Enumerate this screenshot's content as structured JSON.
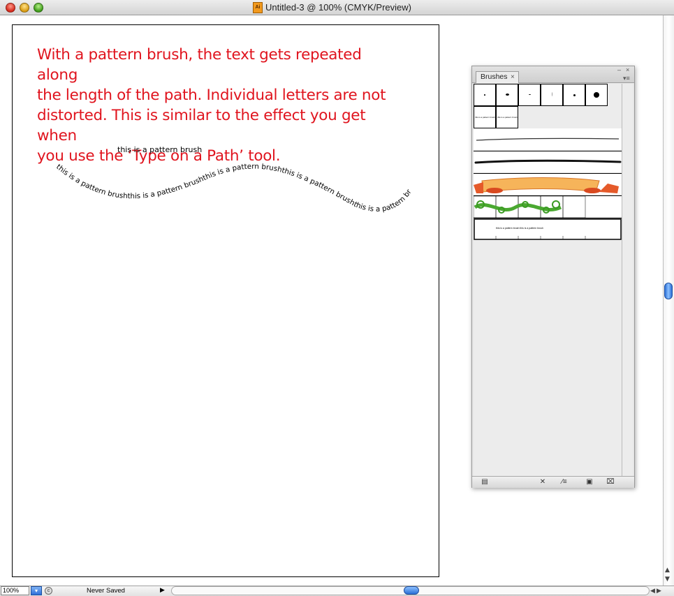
{
  "window": {
    "title": "Untitled-3 @ 100% (CMYK/Preview)",
    "doc_icon_label": "Ai"
  },
  "artboard": {
    "description_lines": [
      "With a pattern brush, the text gets repeated along",
      "the length of the path. Individual letters are not",
      "distorted. This is similar to the effect you get when",
      "you use the ‘Type on a Path’ tool."
    ],
    "sample_text": "this is a pattern brush",
    "wave_text": "this is a pattern brushthis is a pattern brushthis is a pattern brushthis is a pattern brushthis is a pattern brush"
  },
  "brushes_panel": {
    "tab_label": "Brushes",
    "close_glyph": "×",
    "collapse_glyph": "–",
    "panel_close_glyph": "×",
    "menu_glyph": "▾≡",
    "tiny_pattern_text": "this is a pattern brush",
    "pattern_row_text": "this is a pattern brush  this is a pattern brush",
    "bottom_buttons": {
      "libraries": "▤",
      "remove_stroke": "✕",
      "options": "∕≡",
      "new": "▣",
      "delete": "⌧"
    }
  },
  "status_bar": {
    "zoom": "100%",
    "zoom_dropdown": "▾",
    "doc_state": "Never Saved",
    "state_arrow": "▶"
  },
  "scrollbar": {
    "up": "▲",
    "down": "▼",
    "left": "◀",
    "right": "▶"
  }
}
